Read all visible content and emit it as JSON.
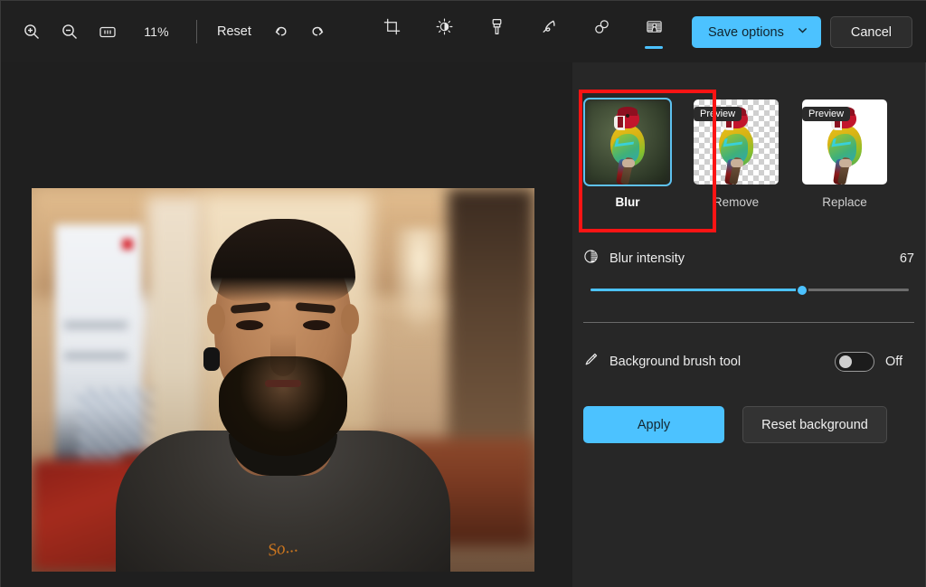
{
  "toolbar": {
    "zoom_in_icon": "zoom-in-icon",
    "zoom_out_icon": "zoom-out-icon",
    "actual_size_icon": "one-to-one-icon",
    "zoom_level": "11%",
    "reset_label": "Reset",
    "undo_icon": "undo-icon",
    "redo_icon": "redo-icon",
    "tools": [
      {
        "name": "crop",
        "icon": "crop-icon",
        "active": false
      },
      {
        "name": "adjustment",
        "icon": "brightness-icon",
        "active": false
      },
      {
        "name": "markup",
        "icon": "paintbrush-icon",
        "active": false
      },
      {
        "name": "pen",
        "icon": "pen-icon",
        "active": false
      },
      {
        "name": "erase",
        "icon": "erase-objects-icon",
        "active": false
      },
      {
        "name": "background",
        "icon": "background-blur-icon",
        "active": true
      }
    ],
    "save_options_label": "Save options",
    "save_options_chevron": "chevron-down-icon",
    "cancel_label": "Cancel"
  },
  "panel": {
    "cards": [
      {
        "label": "Blur",
        "selected": true,
        "badge": null
      },
      {
        "label": "Remove",
        "selected": false,
        "badge": "Preview"
      },
      {
        "label": "Replace",
        "selected": false,
        "badge": "Preview"
      }
    ],
    "blur_intensity": {
      "icon": "blur-intensity-icon",
      "label": "Blur intensity",
      "value": "67",
      "percent": 67,
      "min": 0,
      "max": 100
    },
    "brush_tool": {
      "icon": "brush-pen-icon",
      "label": "Background brush tool",
      "state": "Off",
      "on": false
    },
    "apply_label": "Apply",
    "reset_background_label": "Reset background"
  },
  "annotation": {
    "highlight_color": "#fb1414",
    "target": "Blur"
  },
  "colors": {
    "accent": "#4cc2ff",
    "panel_bg": "#272727",
    "canvas_bg": "#1f1f1f",
    "toolbar_bg": "#202020",
    "selected_border": "#5ec2f0"
  }
}
